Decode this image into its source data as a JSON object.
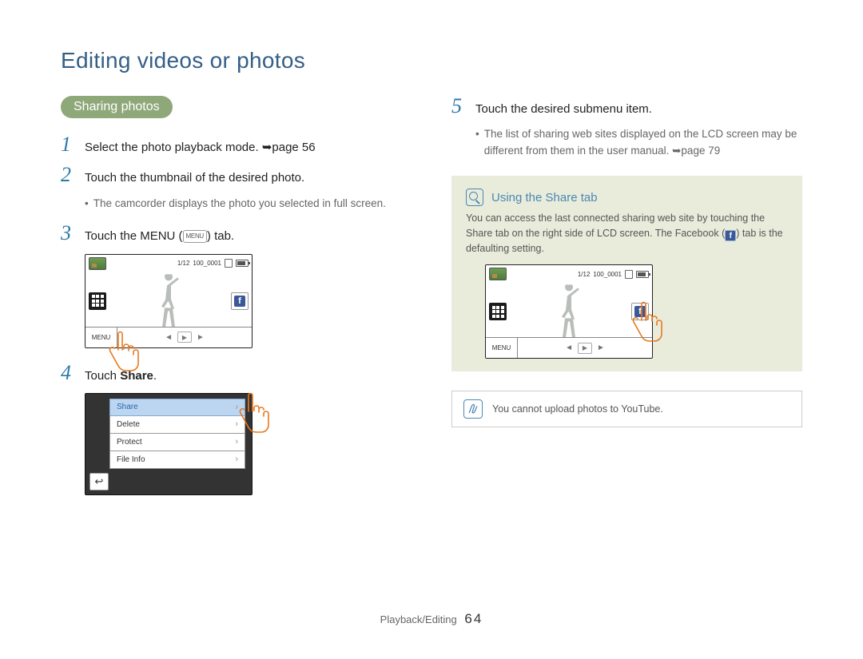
{
  "page": {
    "title": "Editing videos or photos",
    "section_pill": "Sharing photos",
    "footer_label": "Playback/Editing",
    "footer_page": "64"
  },
  "lcd": {
    "counter": "1/12",
    "filename": "100_0001",
    "menu_label": "MENU"
  },
  "left_steps": {
    "s1": {
      "num": "1",
      "text_a": "Select the photo playback mode. ",
      "text_b": "page 56"
    },
    "s2": {
      "num": "2",
      "text": "Touch the thumbnail of the desired photo.",
      "bullet": "The camcorder displays the photo you selected in full screen."
    },
    "s3": {
      "num": "3",
      "text_a": "Touch the MENU (",
      "menu_tag": "MENU",
      "text_b": ") tab."
    },
    "s4": {
      "num": "4",
      "text_a": "Touch ",
      "bold": "Share",
      "text_b": "."
    }
  },
  "menu_items": [
    "Share",
    "Delete",
    "Protect",
    "File Info"
  ],
  "right_steps": {
    "s5": {
      "num": "5",
      "text": "Touch the desired submenu item.",
      "bullet_a": "The list of sharing web sites displayed on the LCD screen may be different from them in the user manual. ",
      "bullet_b": "page 79"
    }
  },
  "tip": {
    "title": "Using the Share tab",
    "text_a": "You can access the last connected sharing web site by touching the Share tab on the right side of LCD screen. The Facebook (",
    "text_b": ") tab is the defaulting setting."
  },
  "note": {
    "text": "You cannot upload photos to YouTube."
  }
}
